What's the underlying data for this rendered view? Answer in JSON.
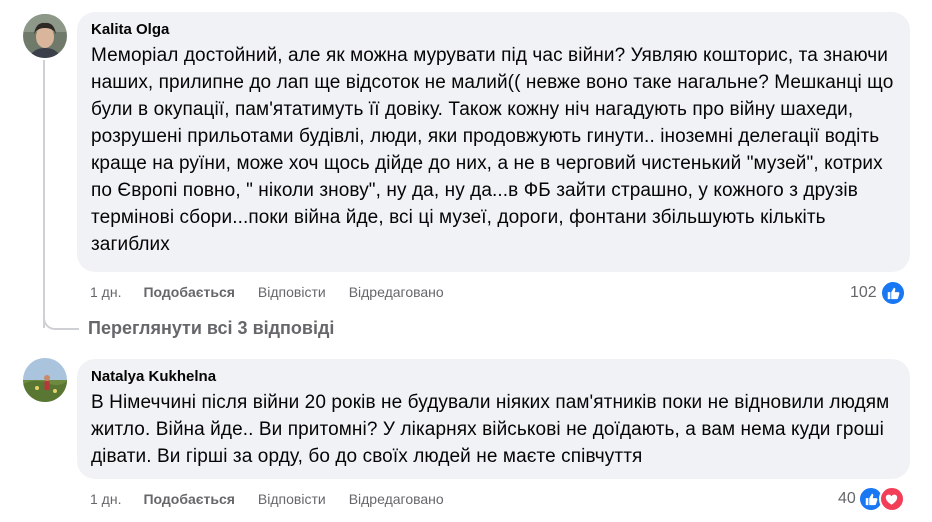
{
  "comments": [
    {
      "author": "Kalita Olga",
      "text": "Меморіал достойний, але як можна мурувати під час війни? Уявляю кошторис, та знаючи наших, прилипне до лап ще відсоток не малий(( невже воно таке нагальне? Мешканці що були в окупації, пам'ятатимуть її довіку. Також кожну ніч нагадують про війну шахеди, розрушені прильотами будівлі, люди, яки продовжують гинути.. іноземні делегації водіть краще на руїни, може хоч щось дійде до них, а не в черговий чистенький \"музей\", котрих по Європі повно, \" ніколи знову\", ну да, ну да...в ФБ зайти страшно, у кожного з друзів термінові сбори...поки війна йде, всі ці музеї, дороги, фонтани збільшують кількіть загиблих",
      "time": "1 дн.",
      "like": "Подобається",
      "reply": "Відповісти",
      "edited": "Відредаговано",
      "reaction_count": "102",
      "reactions": [
        "like-icon"
      ]
    },
    {
      "author": "Natalya Kukhelna",
      "text": "В Німеччині після війни 20 років не будували ніяких пам'ятників поки не відновили людям житло. Війна йде.. Ви притомні? У лікарнях військові не доїдають, а вам нема куди гроші дівати. Ви гірші за орду, бо до своїх людей не маєте співчуття",
      "time": "1 дн.",
      "like": "Подобається",
      "reply": "Відповісти",
      "edited": "Відредаговано",
      "reaction_count": "40",
      "reactions": [
        "like-icon",
        "love-icon"
      ]
    }
  ],
  "view_replies": "Переглянути всі 3 відповіді",
  "colors": {
    "bubble": "#f0f2f5",
    "secondary_text": "#65676b",
    "like_blue": "#1877f2",
    "love_red": "#f33e58"
  }
}
